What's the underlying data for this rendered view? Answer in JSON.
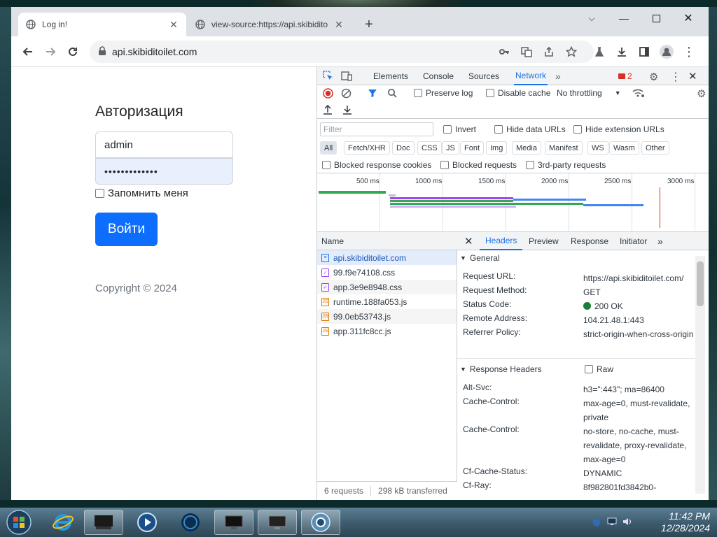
{
  "browser": {
    "tabs": [
      {
        "title": "Log in!",
        "active": true
      },
      {
        "title": "view-source:https://api.skibidito",
        "active": false
      }
    ],
    "new_tab_symbol": "+",
    "url": "api.skibiditoilet.com",
    "window_controls": [
      "minimize",
      "maximize",
      "close"
    ]
  },
  "login": {
    "title": "Авторизация",
    "username": "admin",
    "password_mask": "•••••••••••••",
    "remember_label": "Запомнить меня",
    "button": "Войти",
    "copyright": "Copyright © 2024"
  },
  "devtools": {
    "tabs": [
      "Elements",
      "Console",
      "Sources",
      "Network"
    ],
    "active_tab": "Network",
    "issues_count": "2",
    "toolbar": {
      "preserve_log": "Preserve log",
      "disable_cache": "Disable cache",
      "throttling": "No throttling"
    },
    "filter": {
      "placeholder": "Filter",
      "invert": "Invert",
      "hide_data_urls": "Hide data URLs",
      "hide_extension_urls": "Hide extension URLs"
    },
    "type_filters": [
      "All",
      "Fetch/XHR",
      "Doc",
      "CSS",
      "JS",
      "Font",
      "Img",
      "Media",
      "Manifest",
      "WS",
      "Wasm",
      "Other"
    ],
    "blocked": {
      "response_cookies": "Blocked response cookies",
      "requests": "Blocked requests",
      "third_party": "3rd-party requests"
    },
    "timeline_ticks": [
      "500 ms",
      "1000 ms",
      "1500 ms",
      "2000 ms",
      "2500 ms",
      "3000 ms"
    ],
    "list_header": "Name",
    "requests": [
      {
        "name": "api.skibiditoilet.com",
        "type": "doc"
      },
      {
        "name": "99.f9e74108.css",
        "type": "css"
      },
      {
        "name": "app.3e9e8948.css",
        "type": "css"
      },
      {
        "name": "runtime.188fa053.js",
        "type": "js"
      },
      {
        "name": "99.0eb53743.js",
        "type": "js"
      },
      {
        "name": "app.311fc8cc.js",
        "type": "js"
      }
    ],
    "summary": {
      "requests": "6 requests",
      "transferred": "298 kB transferred"
    },
    "detail_tabs": [
      "Headers",
      "Preview",
      "Response",
      "Initiator"
    ],
    "general": {
      "title": "General",
      "request_url_k": "Request URL:",
      "request_url_v": "https://api.skibiditoilet.com/",
      "method_k": "Request Method:",
      "method_v": "GET",
      "status_k": "Status Code:",
      "status_v": "200 OK",
      "remote_k": "Remote Address:",
      "remote_v": "104.21.48.1:443",
      "referrer_k": "Referrer Policy:",
      "referrer_v": "strict-origin-when-cross-origin"
    },
    "response_headers": {
      "title": "Response Headers",
      "raw": "Raw",
      "altsvc_k": "Alt-Svc:",
      "altsvc_v": "h3=\":443\"; ma=86400",
      "cache1_k": "Cache-Control:",
      "cache1_v": "max-age=0, must-revalidate, private",
      "cache2_k": "Cache-Control:",
      "cache2_v": "no-store, no-cache, must-revalidate, proxy-revalidate, max-age=0",
      "cfcache_k": "Cf-Cache-Status:",
      "cfcache_v": "DYNAMIC",
      "cfray_k": "Cf-Ray:",
      "cfray_v": "8f982801fd3842b0-"
    }
  },
  "taskbar": {
    "time": "11:42 PM",
    "date": "12/28/2024"
  },
  "colors": {
    "accent": "#1a73e8",
    "login_button": "#0d6efd",
    "status_ok": "#188038"
  }
}
